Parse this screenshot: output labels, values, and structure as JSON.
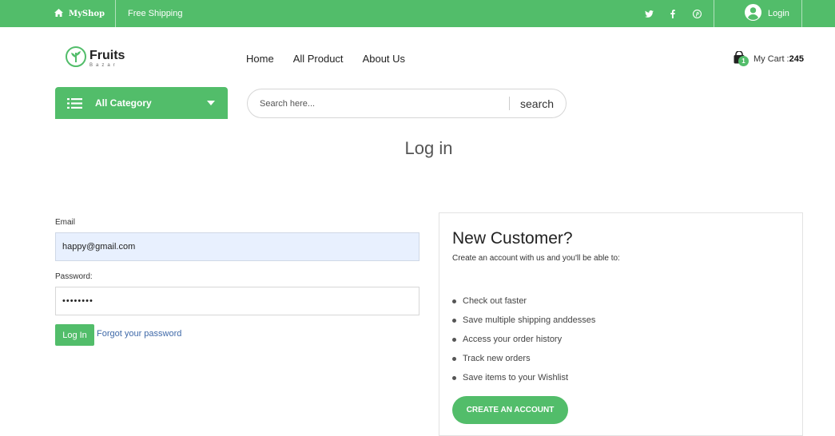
{
  "topbar": {
    "shop_name": "MyShop",
    "shipping": "Free Shipping",
    "social": [
      "twitter-icon",
      "facebook-icon",
      "pinterest-icon"
    ],
    "login": "Login",
    "color": "#52bd6a"
  },
  "header": {
    "logo_title": "Fruits",
    "logo_sub": "Bazar",
    "nav": [
      "Home",
      "All Product",
      "About Us"
    ],
    "cart_label": "My Cart :",
    "cart_amount": "245",
    "cart_count": "1"
  },
  "category": {
    "label": "All Category"
  },
  "search": {
    "placeholder": "Search here...",
    "button": "search"
  },
  "page_title": "Log in",
  "login_form": {
    "email_label": "Email",
    "email_value": "happy@gmail.com",
    "password_label": "Password:",
    "password_mask": "••••••••",
    "submit": "Log In",
    "forgot": "Forgot your password"
  },
  "new_customer": {
    "title": "New Customer?",
    "intro": "Create an account with us and you'll be able to:",
    "benefits": [
      "Check out faster",
      "Save multiple shipping anddesses",
      "Access your order history",
      "Track new orders",
      "Save items to your Wishlist"
    ],
    "button": "CREATE AN ACCOUNT"
  }
}
